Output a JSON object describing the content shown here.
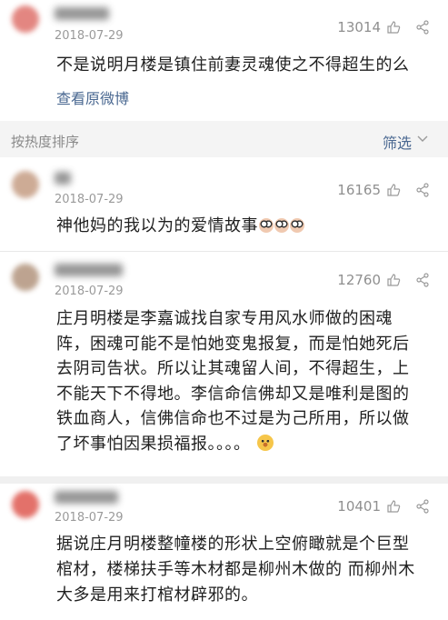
{
  "comments": [
    {
      "date": "2018-07-29",
      "likes": "13014",
      "text": "不是说明月楼是镇住前妻灵魂使之不得超生的么",
      "link": "查看原微博",
      "avatar_color": "#e07a74"
    },
    {
      "date": "2018-07-29",
      "likes": "16165",
      "text": "神他妈的我以为的爱情故事",
      "emoji": [
        "face-icon",
        "face-icon",
        "face-icon"
      ],
      "avatar_color": "#c8a28a"
    },
    {
      "date": "2018-07-29",
      "likes": "12760",
      "lines": [
        "庄月明楼是李嘉诚找自家专用风水师做的困魂",
        "阵，困魂可能不是怕她变鬼报复，而是怕她死后",
        "去阴司告状。所以让其魂留人间，不得超生，上",
        "不能天下不得地。李信命信佛却又是唯利是图的",
        "铁血商人，信佛信命也不过是为己所用，所以做",
        "了坏事怕因果损福报。。。。"
      ],
      "avatar_color": "#b69a84"
    },
    {
      "date": "2018-07-29",
      "likes": "10401",
      "lines": [
        "据说庄月明楼整幢楼的形状上空俯瞰就是个巨型",
        "棺材，楼梯扶手等木材都是柳州木做的 而柳州木",
        "大多是用来打棺材辟邪的。"
      ],
      "avatar_color": "#e0625a"
    }
  ],
  "sort_bar": {
    "label": "按热度排序",
    "filter": "筛选"
  },
  "colors": {
    "link": "#4a6891",
    "meta": "#9a9a9a",
    "background": "#ffffff"
  }
}
